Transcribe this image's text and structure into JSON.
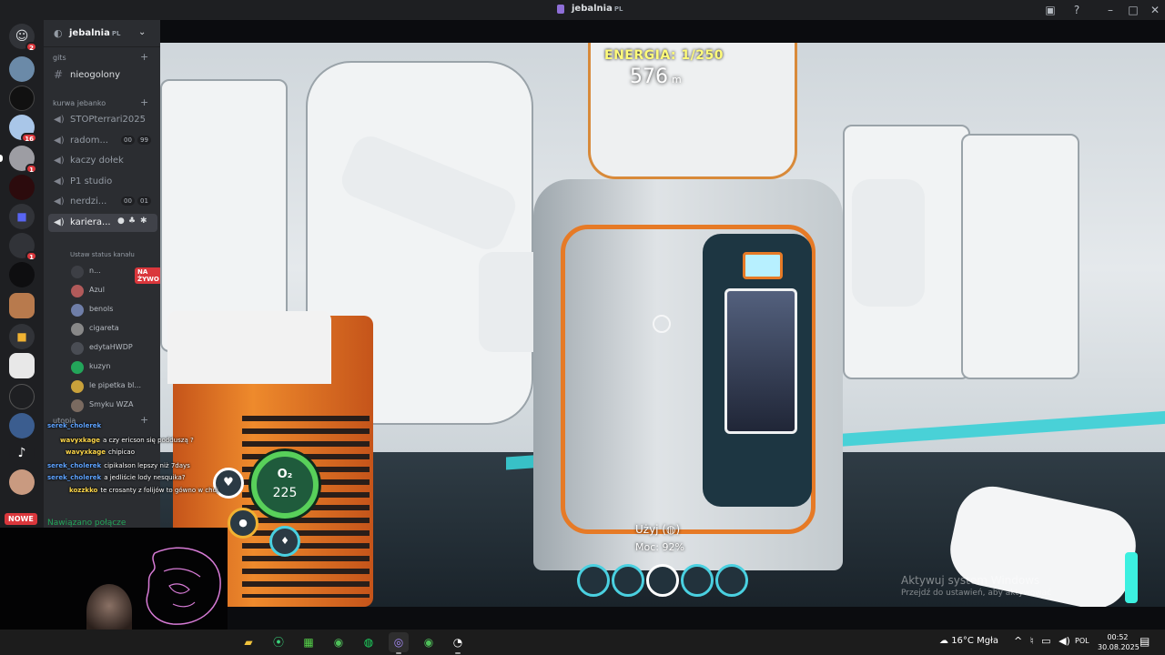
{
  "window": {
    "title": "jebalnia",
    "title_tag": "PL"
  },
  "server": {
    "name": "jebalnia",
    "name_tag": "PL"
  },
  "rail": {
    "badges": [
      "2",
      "16",
      "1",
      "1"
    ],
    "now_label": "NOWE"
  },
  "categories": {
    "gits": "gits",
    "kurwa": "kurwa jebanko",
    "utopia": "utopia"
  },
  "channels": {
    "text": "nieogolony",
    "voice": [
      {
        "label": "STOPterrari2025"
      },
      {
        "label": "radom...",
        "counts": [
          "00",
          "99"
        ]
      },
      {
        "label": "kaczy dołek"
      },
      {
        "label": "P1 studio"
      },
      {
        "label": "nerdzi...",
        "counts": [
          "00",
          "01"
        ]
      },
      {
        "label": "kariera..."
      }
    ],
    "status_hint": "Ustaw status kanału"
  },
  "members": [
    {
      "name": "n...",
      "live": "NA ŻYWO",
      "color": "#3d3f45"
    },
    {
      "name": "Azul",
      "color": "#b15a5a"
    },
    {
      "name": "benols",
      "color": "#6f7ea8"
    },
    {
      "name": "cigareta",
      "color": "#888888"
    },
    {
      "name": "edytaHWDP",
      "color": "#4a4d54"
    },
    {
      "name": "kuzyn",
      "color": "#23a55a"
    },
    {
      "name": "le pipetka bl...",
      "color": "#c9a13b"
    },
    {
      "name": "Smyku WZA",
      "color": "#7a6a60"
    }
  ],
  "connection": {
    "status": "Nawiązano połącze"
  },
  "hud": {
    "energy": "ENERGIA: 1/250",
    "depth_value": "576",
    "depth_unit": "m",
    "o2_label": "O₂",
    "o2_value": "225",
    "use_prompt": "Użyj",
    "power": "Moc: 92%"
  },
  "chat": [
    {
      "user": "serek_cholerek",
      "text": "",
      "color": "#5ea3ff"
    },
    {
      "user": "wavyxkage",
      "text": "a czy ericson się podduszą ?",
      "color": "#ffd84a"
    },
    {
      "user": "wavyxkage",
      "text": "chipicao",
      "color": "#ffd84a"
    },
    {
      "user": "serek_cholerek",
      "text": "cipikalson lepszy niż 7days",
      "color": "#5ea3ff"
    },
    {
      "user": "serek_cholerek",
      "text": "a jedliście lody nesquika?",
      "color": "#5ea3ff"
    },
    {
      "user": "kozzkko",
      "text": "te crosanty z folijów to gówno w chuj",
      "color": "#ffd84a"
    }
  ],
  "watermark": {
    "line1": "Aktywuj system Windows",
    "line2": "Przejdź do ustawień, aby aktywować"
  },
  "taskbar": {
    "weather": "16°C  Mgła",
    "lang": "POL",
    "time": "00:52",
    "date": "30.08.2025"
  }
}
